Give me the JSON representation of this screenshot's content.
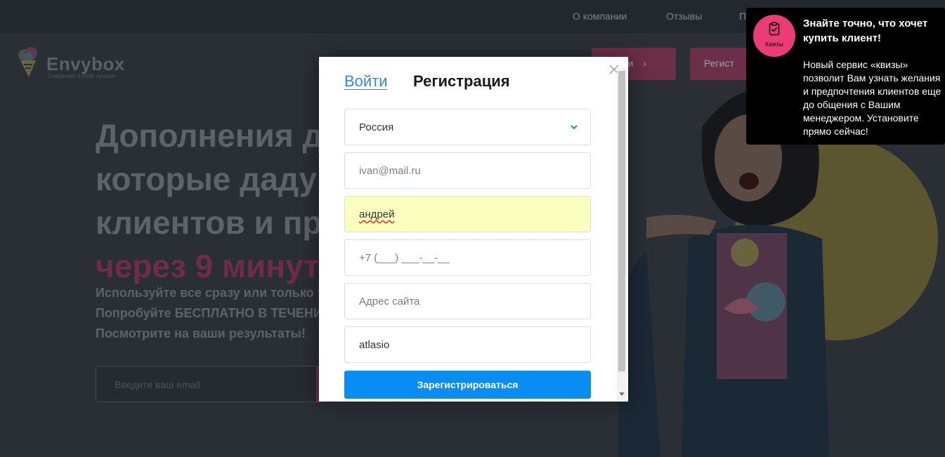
{
  "nav": {
    "links": [
      "О компании",
      "Отзывы",
      "П"
    ]
  },
  "brand": {
    "name": "Envybox",
    "tagline": "Соединяет в себе лучшее"
  },
  "header_buttons": {
    "login": "Войти",
    "register": "Регист"
  },
  "hero": {
    "line1": "Дополнения д",
    "line2": "которые даду",
    "line3": "клиентов и пр",
    "line4": "через 9 минут",
    "sub1": "Используйте все сразу или только то",
    "sub2": "Попробуйте БЕСПЛАТНО В ТЕЧЕНИЕ",
    "sub3": "Посмотрите на ваши результаты!",
    "email_placeholder": "Введите ваш email"
  },
  "modal": {
    "tab_login": "Войти",
    "tab_register": "Регистрация",
    "country": "Россия",
    "email_placeholder": "ivan@mail.ru",
    "name_value": "андрей",
    "phone_placeholder": "+7 (___) ___-__-__",
    "site_placeholder": "Адрес сайта",
    "extra_value": "atlasio",
    "submit": "Зарегистрироваться"
  },
  "notification": {
    "badge_label": "Квизы",
    "title": "Знайте точно, что хочет купить клиент!",
    "body": "Новый сервис «квизы» позволит Вам узнать желания и предпочтения клиентов еще до общения с Вашим менеджером. Установите прямо сейчас!"
  },
  "colors": {
    "accent_blue": "#0a8df2",
    "brand_pink": "#e83d77",
    "autofill_yellow": "#fbffbd"
  }
}
